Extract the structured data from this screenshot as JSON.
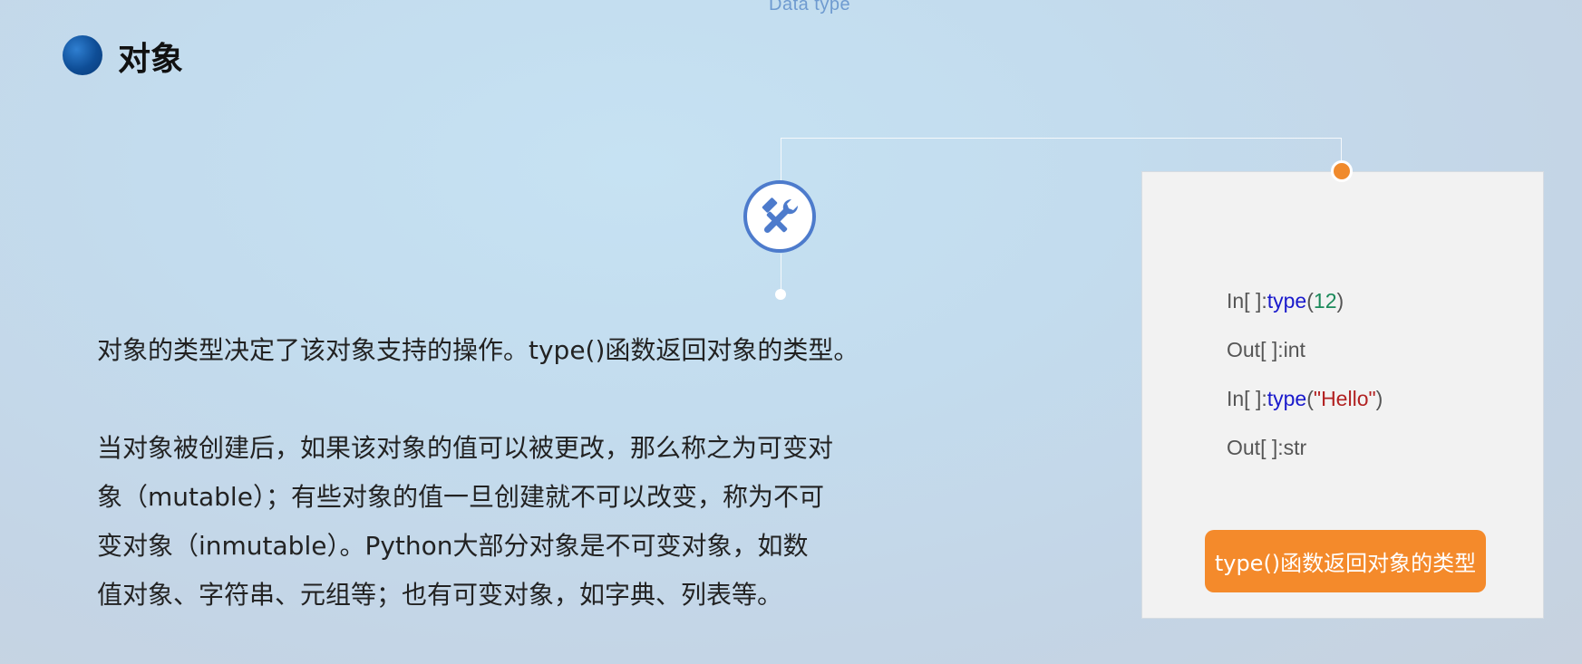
{
  "header": {
    "subtitle": "Data type",
    "title": "对象"
  },
  "content": {
    "paragraph1": "对象的类型决定了该对象支持的操作。type()函数返回对象的类型。",
    "paragraph2_lines": [
      "当对象被创建后，如果该对象的值可以被更改，那么称之为可变对",
      "象（mutable）；有些对象的值一旦创建就不可以改变，称为不可",
      "变对象（inmutable）。Python大部分对象是不可变对象，如数",
      "值对象、字符串、元组等；也有可变对象，如字典、列表等。"
    ]
  },
  "code_card": {
    "lines": [
      {
        "prompt": "In[ ]:",
        "func": "type",
        "open": "(",
        "arg": "12",
        "close": ")"
      },
      {
        "prompt": "Out[ ]:",
        "result": "int"
      },
      {
        "prompt": "In[ ]:",
        "func": "type",
        "open": "(",
        "arg": "\"Hello\"",
        "close": ")"
      },
      {
        "prompt": "Out[ ]:",
        "result": "str"
      }
    ],
    "button_label": "type()函数返回对象的类型"
  },
  "icons": {
    "title_bullet": "circle-bullet-icon",
    "tools": "tools-icon"
  },
  "colors": {
    "accent_blue": "#0e4d96",
    "icon_ring": "#4d7bcc",
    "orange": "#f48a2b",
    "keyword": "#1a1acc",
    "number": "#1a8a5a",
    "string": "#b22222"
  }
}
